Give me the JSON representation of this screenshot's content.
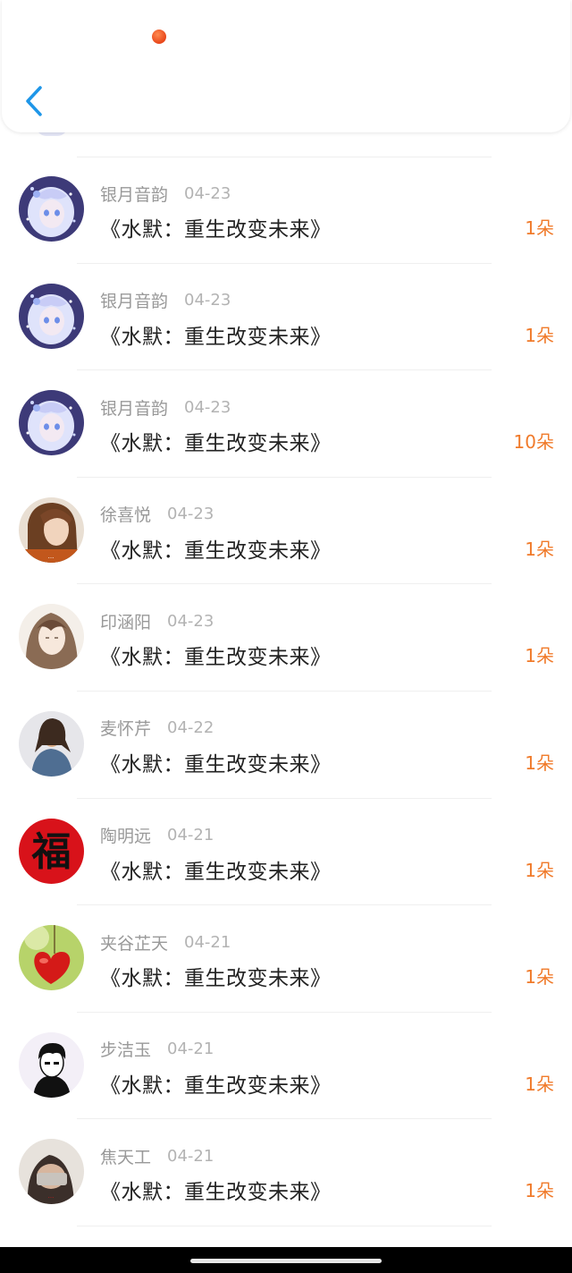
{
  "colors": {
    "accent": "#f07a2a",
    "back": "#1e96e8",
    "name": "#999999",
    "title": "#222222"
  },
  "header": {
    "back_icon": "chevron-left-icon"
  },
  "records": [
    {
      "name": "银月音韵",
      "date": "04-23",
      "title": "《水默：重生改变未来》",
      "amount": "1朵",
      "avatar": "anime-girl-blue"
    },
    {
      "name": "银月音韵",
      "date": "04-23",
      "title": "《水默：重生改变未来》",
      "amount": "1朵",
      "avatar": "anime-girl-blue"
    },
    {
      "name": "银月音韵",
      "date": "04-23",
      "title": "《水默：重生改变未来》",
      "amount": "10朵",
      "avatar": "anime-girl-blue"
    },
    {
      "name": "徐喜悦",
      "date": "04-23",
      "title": "《水默：重生改变未来》",
      "amount": "1朵",
      "avatar": "woman-brown-hair"
    },
    {
      "name": "印涵阳",
      "date": "04-23",
      "title": "《水默：重生改变未来》",
      "amount": "1朵",
      "avatar": "sketch-girl"
    },
    {
      "name": "麦怀芹",
      "date": "04-22",
      "title": "《水默：重生改变未来》",
      "amount": "1朵",
      "avatar": "woman-denim"
    },
    {
      "name": "陶明远",
      "date": "04-21",
      "title": "《水默：重生改变未来》",
      "amount": "1朵",
      "avatar": "fu-character-red"
    },
    {
      "name": "夹谷芷天",
      "date": "04-21",
      "title": "《水默：重生改变未来》",
      "amount": "1朵",
      "avatar": "red-heart-green"
    },
    {
      "name": "步洁玉",
      "date": "04-21",
      "title": "《水默：重生改变未来》",
      "amount": "1朵",
      "avatar": "cartoon-boy-sketch"
    },
    {
      "name": "焦天工",
      "date": "04-21",
      "title": "《水默：重生改变未来》",
      "amount": "1朵",
      "avatar": "person-hiding-face"
    }
  ]
}
